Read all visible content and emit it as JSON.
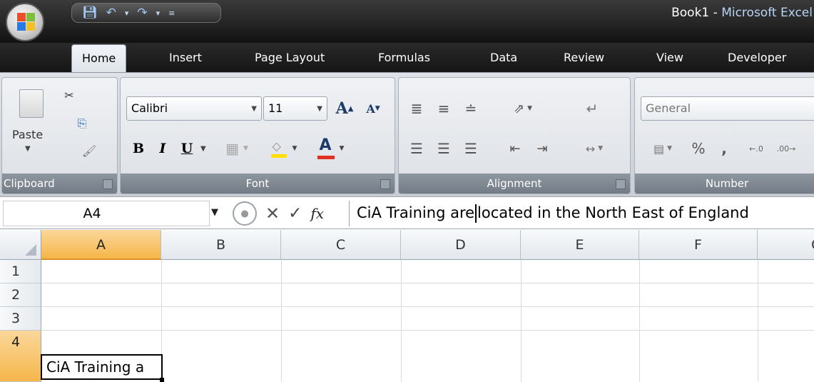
{
  "window": {
    "doc_title": "Book1",
    "separator": " - ",
    "app_name": "Microsoft Excel"
  },
  "tabs": [
    "Home",
    "Insert",
    "Page Layout",
    "Formulas",
    "Data",
    "Review",
    "View",
    "Developer"
  ],
  "active_tab": "Home",
  "ribbon": {
    "clipboard": {
      "label": "Clipboard",
      "paste_label": "Paste"
    },
    "font": {
      "label": "Font",
      "font_name": "Calibri",
      "font_size": "11",
      "bold": "B",
      "italic": "I",
      "underline": "U"
    },
    "alignment": {
      "label": "Alignment"
    },
    "number": {
      "label": "Number",
      "format": "General",
      "percent": "%",
      "comma": ","
    }
  },
  "formula_bar": {
    "name_box": "A4",
    "fx": "fx",
    "content_before_caret": "CiA Training are",
    "content_after_caret": "located in the North East of England"
  },
  "grid": {
    "columns": [
      "A",
      "B",
      "C",
      "D",
      "E",
      "F",
      "G"
    ],
    "rows": [
      "1",
      "2",
      "3",
      "4"
    ],
    "active_cell_display": "CiA Training a"
  },
  "colors": {
    "selection_header": "#f5b64a",
    "title_app": "#b8d4f4",
    "font_color_bar": "#e03020",
    "highlight_bar": "#ffe000"
  }
}
